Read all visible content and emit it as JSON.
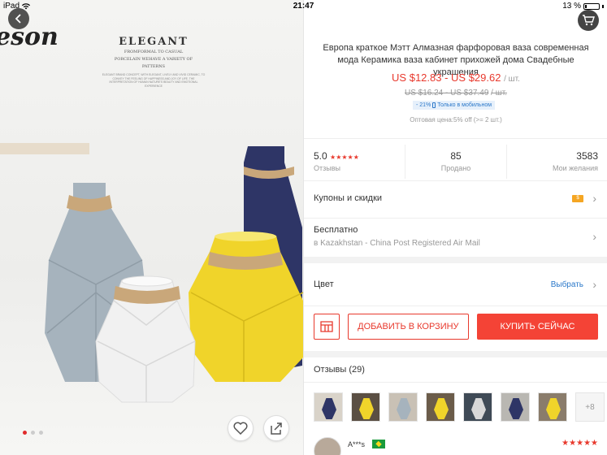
{
  "status_bar": {
    "device": "iPad",
    "time": "21:47",
    "battery": "13 %"
  },
  "photo": {
    "brand_text": "eson",
    "banner_title": "ELEGANT",
    "banner_line1": "FROMFORMAL TO CASUAL",
    "banner_line2": "PORCELAIN WEHAVE A VARIETY OF",
    "banner_line3": "PATTERNS",
    "banner_fine_print": "ELEGANT BRAND CONCEPT, WITH ELEGANT, LIVELY AND VIVID CERAMIC, TO CONVEY THE FEELING OF HAPPINESS AND JOY OF LIFE. THE INTERPRETATION OF HUMAN NATURE'S BEAUTY AND EMOTIONAL EXPERIENCE",
    "vase_colors": {
      "grey": "#a6b3bd",
      "navy": "#2e3566",
      "yellow": "#f0d42a",
      "white": "#f1f1f1",
      "twine": "#c9a77a"
    }
  },
  "product": {
    "title": "Европа краткое Мэтт Алмазная фарфоровая ваза современная мода Керамика ваза кабинет прихожей дома Свадебные украшения",
    "price": "US $12.83 - US $29.62",
    "price_unit": "/ шт.",
    "old_price": "US $16.24 - US $37.49",
    "old_price_unit": "/ шт.",
    "discount": "- 21%",
    "mobile_only": "Только в мобильном",
    "wholesale": "Оптовая цена:5% off (>= 2 шт.)"
  },
  "stats": {
    "rating_value": "5.0",
    "rating_stars": "★★★★★",
    "rating_label": "Отзывы",
    "sold_value": "85",
    "sold_label": "Продано",
    "wish_value": "3583",
    "wish_label": "Мои желания"
  },
  "rows": {
    "coupons_label": "Купоны и скидки",
    "coupon_tag": "$",
    "shipping_label": "Бесплатно",
    "shipping_sub": "в Kazakhstan - China Post Registered Air Mail",
    "color_label": "Цвет",
    "color_action": "Выбрать"
  },
  "actions": {
    "add_to_cart": "ДОБАВИТЬ В КОРЗИНУ",
    "buy_now": "КУПИТЬ СЕЙЧАС"
  },
  "reviews": {
    "title": "Отзывы (29)",
    "more_count": "+8",
    "thumb_colors": [
      "#2e3566",
      "#f0d42a",
      "#a6b3bd",
      "#f0d42a",
      "#d8d8d8",
      "#2e3566",
      "#f0d42a"
    ],
    "reviewer_name": "A***s",
    "reviewer_stars": "★★★★★"
  },
  "colors": {
    "accent": "#e8392d",
    "link": "#2b78c9"
  }
}
